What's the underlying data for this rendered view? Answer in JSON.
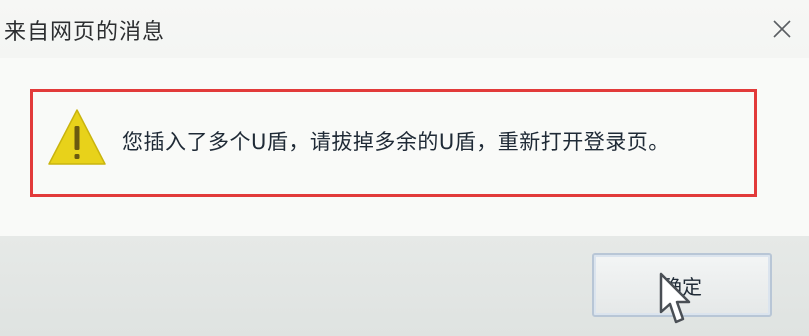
{
  "dialog": {
    "title": "来自网页的消息",
    "message": "您插入了多个U盾，请拔掉多余的U盾，重新打开登录页。",
    "ok_label": "确定",
    "icons": {
      "close": "close-icon",
      "warning": "warning-icon",
      "cursor": "mouse-cursor-icon"
    },
    "colors": {
      "highlight_border": "#e23a3a",
      "warning_fill": "#e8d21a"
    }
  }
}
